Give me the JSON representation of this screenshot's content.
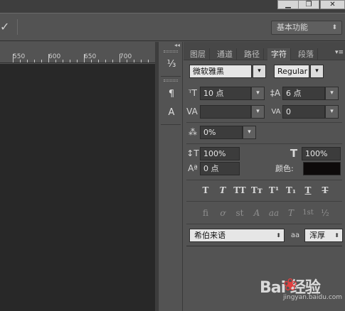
{
  "window": {
    "minimize_icon": "minus",
    "restore_icon": "restore",
    "close_icon": "close"
  },
  "options_bar": {
    "commit_icon": "checkmark",
    "workspace_label": "基本功能"
  },
  "ruler": {
    "labels": [
      "550",
      "600",
      "650",
      "700"
    ]
  },
  "panel_tabs": [
    {
      "label": "图层",
      "active": false
    },
    {
      "label": "通道",
      "active": false
    },
    {
      "label": "路径",
      "active": false
    },
    {
      "label": "字符",
      "active": true
    },
    {
      "label": "段落",
      "active": false
    }
  ],
  "character": {
    "font_family": "微软雅黑",
    "font_style": "Regular",
    "font_size": "10 点",
    "leading": "6 点",
    "kerning": "",
    "tracking": "0",
    "tsume": "0%",
    "vertical_scale": "100%",
    "horizontal_scale": "100%",
    "baseline_shift": "0 点",
    "color_label": "颜色:",
    "color_value": "#0d0a0a",
    "language": "希伯来语",
    "aa_icon_label": "aa",
    "antialias": "浑厚"
  },
  "style_buttons": [
    "T",
    "T",
    "TT",
    "Tт",
    "T¹",
    "T₁",
    "T",
    "T"
  ],
  "opentype_buttons": [
    "fi",
    "ơ",
    "st",
    "A",
    "aa",
    "T",
    "1st",
    "½"
  ],
  "watermark": {
    "brand": "Bai  经验",
    "url": "jingyan.baidu.com"
  }
}
